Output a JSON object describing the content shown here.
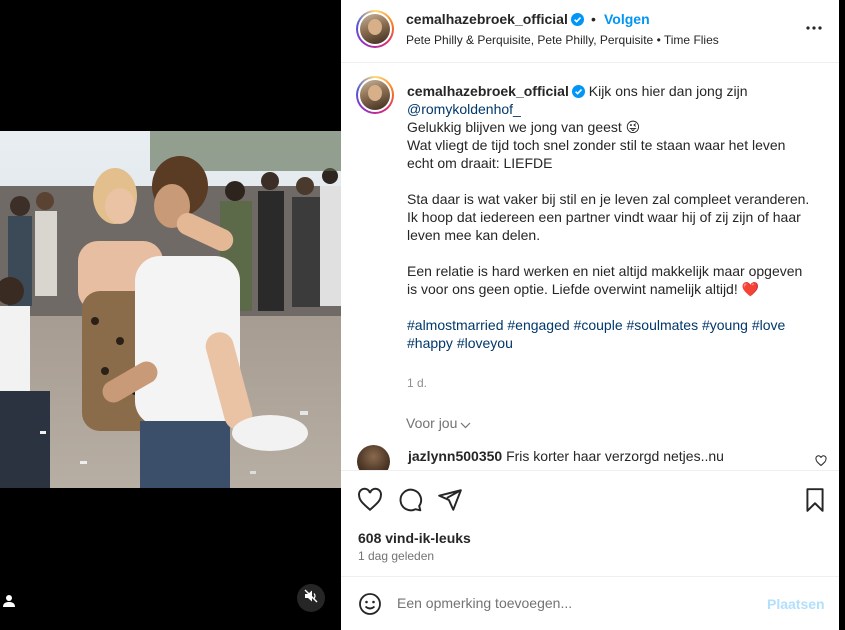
{
  "post": {
    "username": "cemalhazebroek_official",
    "follow_separator": "•",
    "follow_label": "Volgen",
    "subtitle": "Pete Philly & Perquisite, Pete Philly, Perquisite • Time Flies"
  },
  "caption": {
    "username": "cemalhazebroek_official",
    "first_line": "Kijk ons hier dan jong zijn",
    "mention": "@romykoldenhof_",
    "line2": "Gelukkig blijven we jong van geest 😜",
    "line3": "Wat vliegt de tijd toch snel zonder stil te staan waar het leven echt om draait: LIEFDE",
    "para2": "Sta daar is wat vaker bij stil en je leven zal compleet veranderen. Ik hoop dat iedereen een partner vindt waar hij of zij zijn of haar leven mee kan delen.",
    "para3": "Een relatie is hard werken en niet altijd makkelijk maar opgeven is voor ons geen optie. Liefde overwint namelijk altijd! ❤️",
    "hashtags": [
      "#almostmarried",
      "#engaged",
      "#couple",
      "#soulmates",
      "#young",
      "#love",
      "#happy",
      "#loveyou"
    ],
    "time": "1 d."
  },
  "for_you_label": "Voor jou",
  "comment": {
    "username": "jazlynn500350",
    "text": "Fris korter haar verzorgd netjes..nu"
  },
  "likes": "608 vind-ik-leuks",
  "posted_ago": "1 dag geleden",
  "add_comment": {
    "placeholder": "Een opmerking toevoegen...",
    "post_label": "Plaatsen"
  },
  "colors": {
    "link": "#00376b",
    "follow": "#0095f6",
    "post_disabled": "#b2dffc",
    "verified": "#0095f6"
  },
  "icons": [
    "user-tag-icon",
    "muted-speaker-icon",
    "verified-badge-icon",
    "more-options-icon",
    "chevron-down-icon",
    "heart-icon",
    "comment-icon",
    "share-icon",
    "bookmark-icon",
    "emoji-icon"
  ]
}
